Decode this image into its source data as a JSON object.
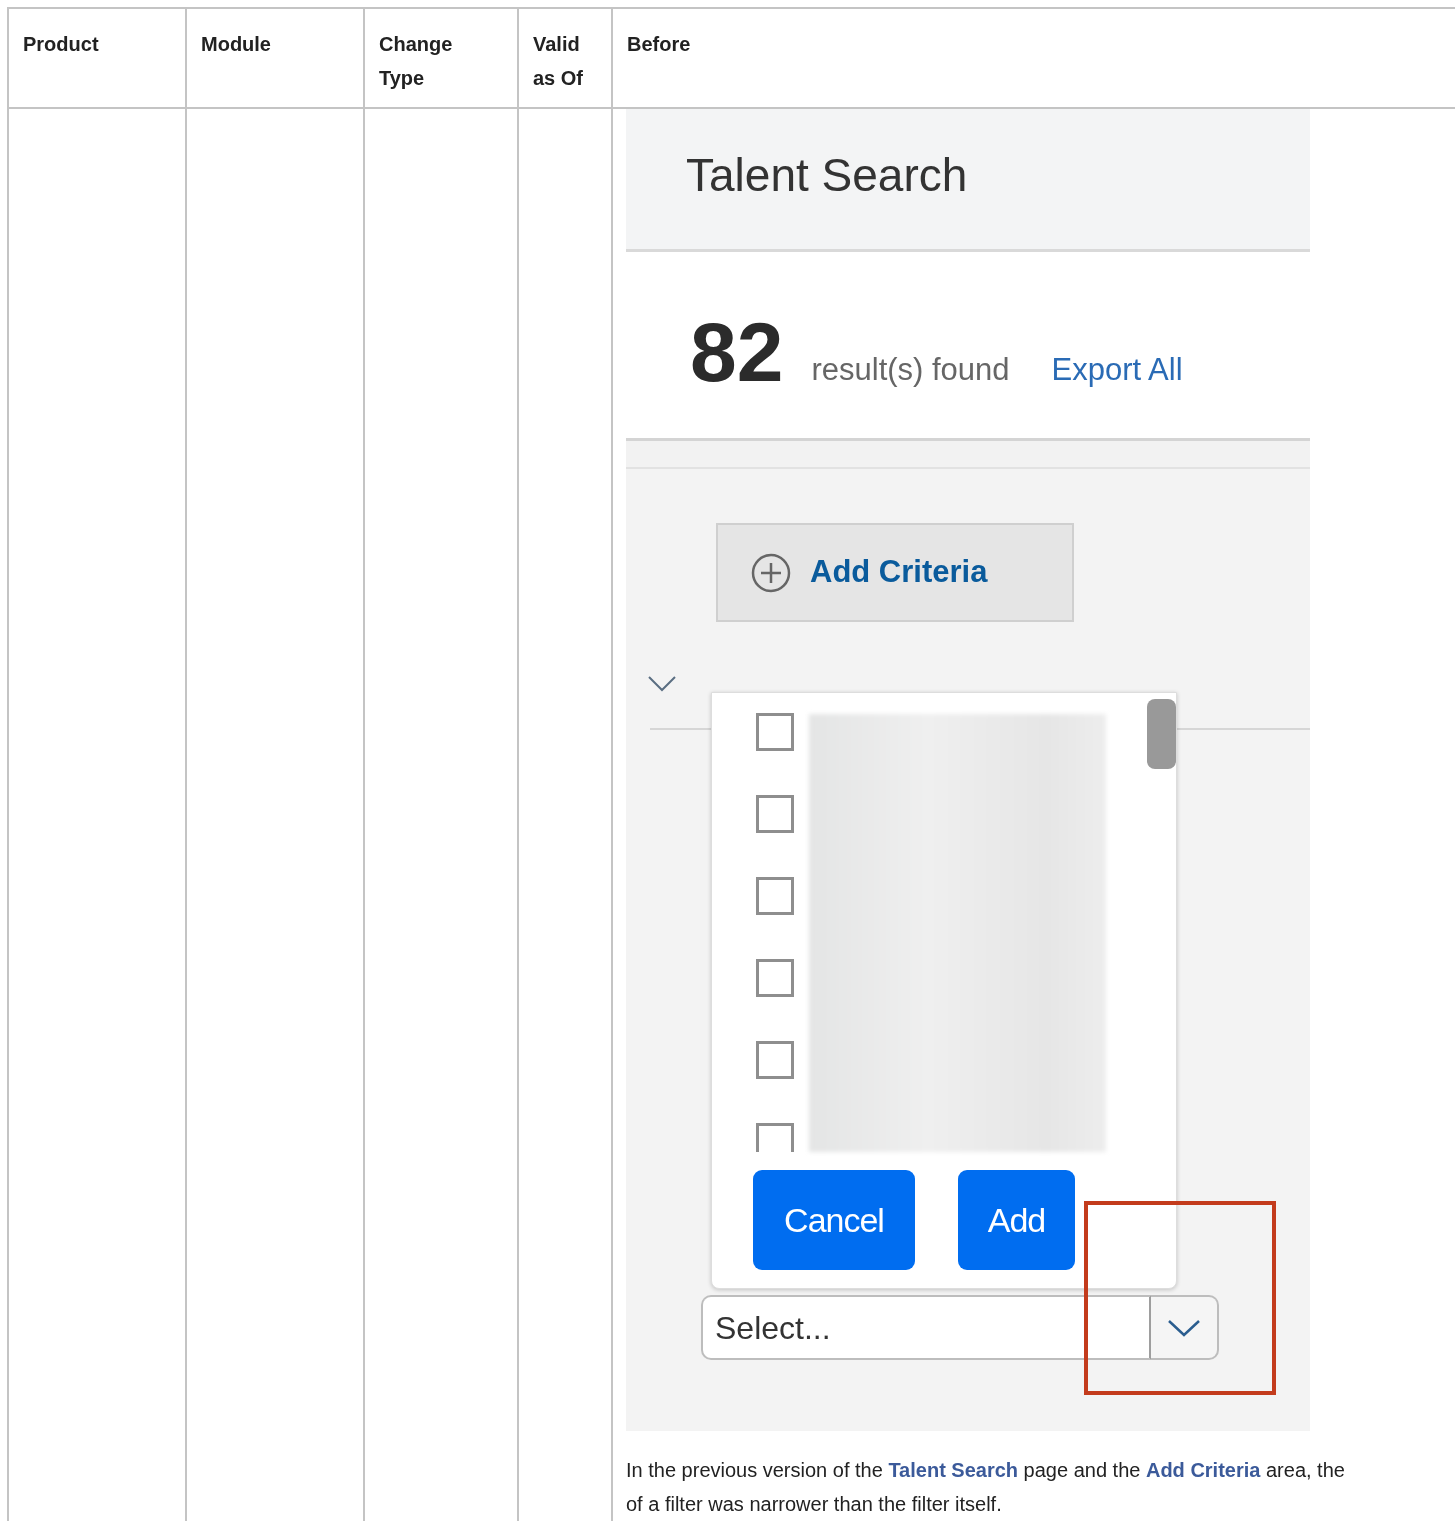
{
  "table": {
    "columns": [
      "Product",
      "Module",
      "Change Type",
      "Valid as Of",
      "Before"
    ],
    "before": {
      "screenshot": {
        "title": "Talent Search",
        "result_count": "82",
        "result_label": "result(s) found",
        "export_link": "Export All",
        "add_criteria_button": "Add Criteria",
        "filter_popup": {
          "options": [
            {
              "checked": false
            },
            {
              "checked": false
            },
            {
              "checked": false
            },
            {
              "checked": false
            },
            {
              "checked": false
            },
            {
              "checked": false
            }
          ],
          "buttons": [
            "Cancel",
            "Add"
          ]
        },
        "select_field": {
          "placeholder": "Select..."
        }
      },
      "caption_lines": [
        "In the previous version of the **Talent Search** page and the **Add Criteria** area, the",
        "of a filter was narrower than the filter itself."
      ]
    }
  }
}
